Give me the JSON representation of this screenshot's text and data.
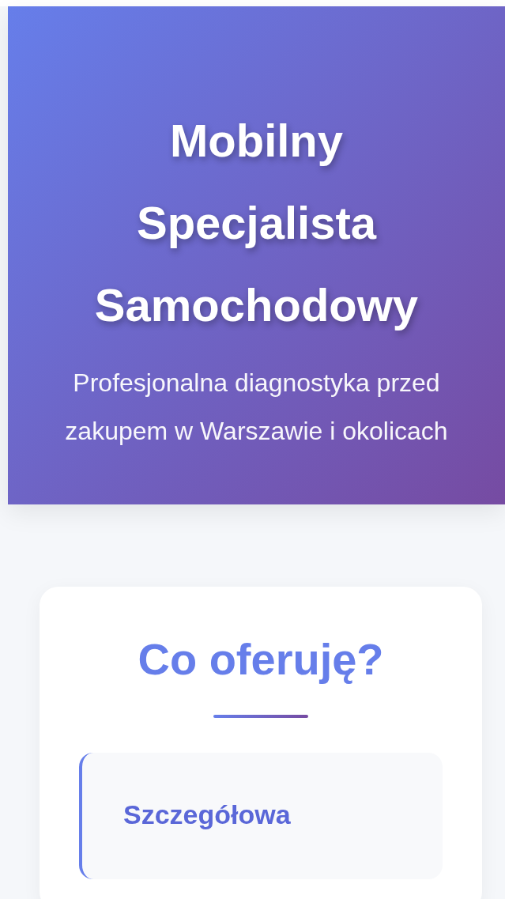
{
  "hero": {
    "title": "Mobilny Specjalista Samochodowy",
    "subtitle": "Profesjonalna diagnostyka przed zakupem w Warszawie i okolicach"
  },
  "offer": {
    "heading": "Co oferuję?",
    "items": [
      {
        "title": "Szczegółowa"
      }
    ]
  }
}
